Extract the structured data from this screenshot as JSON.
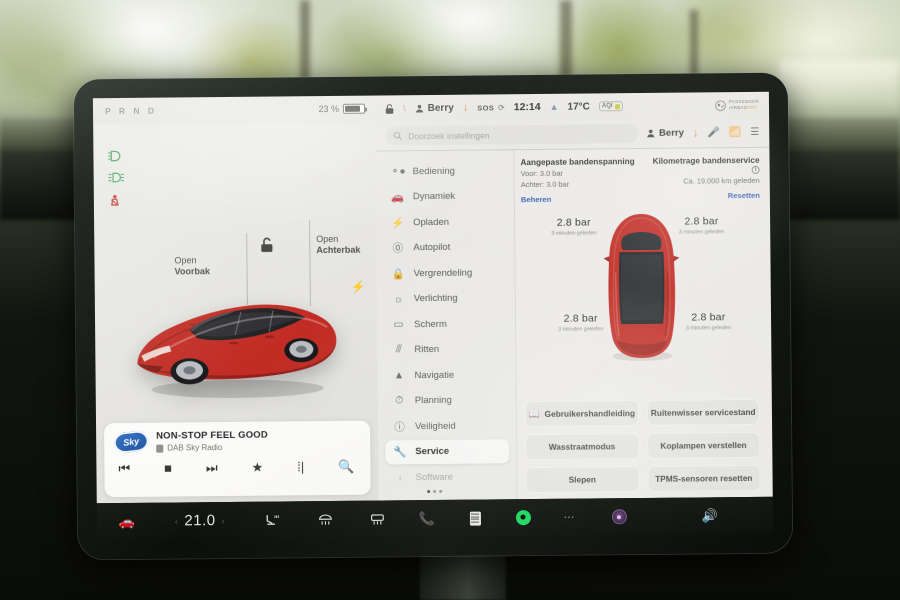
{
  "status_bar": {
    "gear": "P R N D",
    "battery_percent": "23 %",
    "lock_icon": "lock-icon",
    "user": "Berry",
    "download_icon": "download-arrow-icon",
    "sos": "SOS",
    "time": "12:14",
    "outside_temp": "17°C",
    "aqi": "AQI",
    "airbag_line1": "PASSENGER",
    "airbag_line2": "AIRBAG",
    "airbag_status": "OFF"
  },
  "car_panel": {
    "open_front_line1": "Open",
    "open_front_line2": "Voorbak",
    "open_rear_line1": "Open",
    "open_rear_line2": "Achterbak",
    "lock_icon": "unlocked-padlock-icon",
    "charge_icon": "charge-port-bolt-icon",
    "telltales": [
      "headlight-on-green",
      "parking-light-green",
      "seatbelt-warning-red"
    ]
  },
  "media": {
    "station_logo": "Sky",
    "title": "NON-STOP FEEL GOOD",
    "subtitle": "DAB Sky Radio",
    "controls": [
      "previous-icon",
      "stop-icon",
      "next-icon",
      "favorite-star-icon",
      "equalizer-icon",
      "search-icon"
    ]
  },
  "settings": {
    "search_placeholder": "Doorzoek instellingen",
    "profile_name": "Berry",
    "nav_items": [
      {
        "label": "Bediening",
        "icon": "toggle-switch-icon"
      },
      {
        "label": "Dynamiek",
        "icon": "car-side-icon"
      },
      {
        "label": "Opladen",
        "icon": "bolt-icon"
      },
      {
        "label": "Autopilot",
        "icon": "steering-wheel-icon"
      },
      {
        "label": "Vergrendeling",
        "icon": "padlock-icon"
      },
      {
        "label": "Verlichting",
        "icon": "sun-brightness-icon"
      },
      {
        "label": "Scherm",
        "icon": "display-icon"
      },
      {
        "label": "Ritten",
        "icon": "road-fork-icon"
      },
      {
        "label": "Navigatie",
        "icon": "navigation-arrow-icon"
      },
      {
        "label": "Planning",
        "icon": "clock-icon"
      },
      {
        "label": "Veiligheid",
        "icon": "alert-circle-icon"
      },
      {
        "label": "Service",
        "icon": "wrench-icon"
      },
      {
        "label": "Software",
        "icon": "download-icon"
      }
    ],
    "active_nav": "Service"
  },
  "service_panel": {
    "pressure_title": "Aangepaste bandenspanning",
    "pressure_front": "Voor: 3.0 bar",
    "pressure_rear": "Achter: 3.0 bar",
    "pressure_link": "Beheren",
    "mileage_title": "Kilometrage bandenservice",
    "mileage_value": "Ca. 19.000 km geleden",
    "mileage_link": "Resetten",
    "tires": [
      {
        "position": "front-left",
        "value": "2.8 bar",
        "age": "3 minuten geleden"
      },
      {
        "position": "front-right",
        "value": "2.8 bar",
        "age": "3 minuten geleden"
      },
      {
        "position": "rear-left",
        "value": "2.8 bar",
        "age": "3 minuten geleden"
      },
      {
        "position": "rear-right",
        "value": "2.8 bar",
        "age": "3 minuten geleden"
      }
    ],
    "buttons": [
      {
        "label": "Gebruikershandleiding",
        "icon": "book-icon"
      },
      {
        "label": "Ruitenwisser servicestand",
        "icon": ""
      },
      {
        "label": "Wasstraatmodus",
        "icon": ""
      },
      {
        "label": "Koplampen verstellen",
        "icon": ""
      },
      {
        "label": "Slepen",
        "icon": ""
      },
      {
        "label": "TPMS-sensoren resetten",
        "icon": ""
      }
    ]
  },
  "dock": {
    "car_icon": "car-front-icon",
    "temperature": "21.0",
    "seat_heater_icon": "heated-seat-icon",
    "defrost_front_icon": "front-defrost-icon",
    "defrost_rear_icon": "rear-defrost-icon",
    "phone_icon": "phone-icon",
    "media_icon": "media-player-icon",
    "spotify_icon": "spotify-icon",
    "more_icon": "more-dots-icon",
    "camera_icon": "camera-icon",
    "volume_icon": "volume-icon"
  },
  "colors": {
    "accent_link": "#3b63b5",
    "telltale_green": "#2f9c4a",
    "telltale_red": "#c2352d",
    "download_orange": "#e08b2a",
    "spotify_green": "#1ed760",
    "car_red": "#c0271f"
  }
}
